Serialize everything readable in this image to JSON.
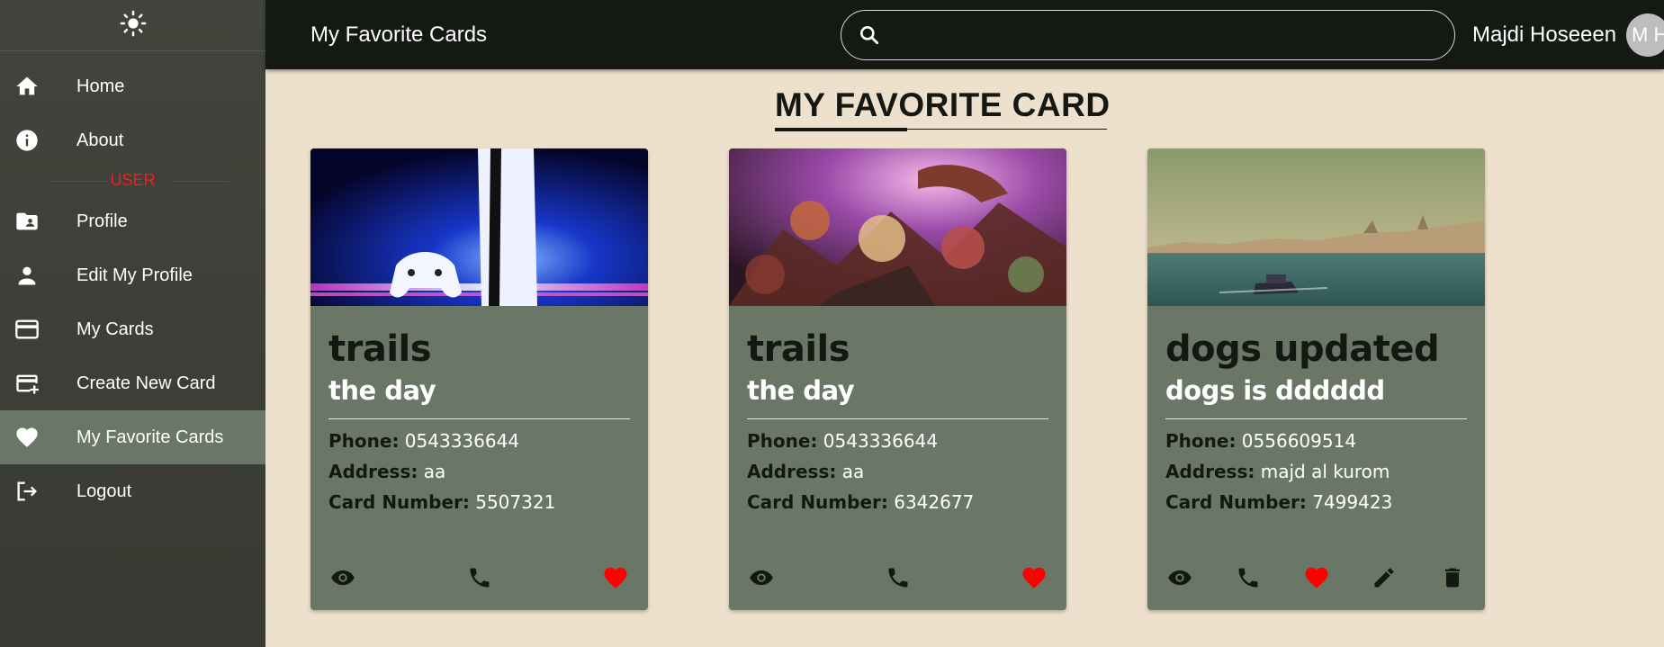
{
  "sidebar": {
    "theme_toggle_icon": "sun-icon",
    "section_label": "USER",
    "items": [
      {
        "label": "Home",
        "icon": "home-icon"
      },
      {
        "label": "About",
        "icon": "info-icon"
      },
      {
        "label": "Profile",
        "icon": "profile-folder-icon"
      },
      {
        "label": "Edit My Profile",
        "icon": "person-icon"
      },
      {
        "label": "My Cards",
        "icon": "credit-card-icon"
      },
      {
        "label": "Create New Card",
        "icon": "add-card-icon"
      },
      {
        "label": "My Favorite Cards",
        "icon": "heart-icon",
        "active": true
      },
      {
        "label": "Logout",
        "icon": "logout-icon"
      }
    ]
  },
  "header": {
    "title": "My Favorite Cards",
    "search_placeholder": "",
    "user_name": "Majdi Hoseeen",
    "avatar_initials": "M H"
  },
  "main": {
    "page_title": "MY FAVORITE CARD",
    "cards": [
      {
        "title": "trails",
        "subtitle": "the day",
        "phone_label": "Phone:",
        "phone": "0543336644",
        "address_label": "Address:",
        "address": "aa",
        "card_number_label": "Card Number:",
        "card_number": "5507321",
        "image": "game-console-image",
        "actions": [
          "eye-icon",
          "phone-icon",
          "heart-icon"
        ]
      },
      {
        "title": "trails",
        "subtitle": "the day",
        "phone_label": "Phone:",
        "phone": "0543336644",
        "address_label": "Address:",
        "address": "aa",
        "card_number_label": "Card Number:",
        "card_number": "6342677",
        "image": "game-characters-image",
        "actions": [
          "eye-icon",
          "phone-icon",
          "heart-icon"
        ]
      },
      {
        "title": "dogs updated",
        "subtitle": "dogs is dddddd",
        "phone_label": "Phone:",
        "phone": "0556609514",
        "address_label": "Address:",
        "address": "majd al kurom",
        "card_number_label": "Card Number:",
        "card_number": "7499423",
        "image": "city-sea-image",
        "actions": [
          "eye-icon",
          "phone-icon",
          "heart-icon",
          "edit-icon",
          "delete-icon"
        ]
      }
    ]
  },
  "colors": {
    "sidebar_bg": "#3c3f37",
    "active_item": "#6b7766",
    "header_bg": "#141913",
    "page_bg": "#ede0cc",
    "card_bg": "#6b7766",
    "favorite": "#ff0000",
    "section_label": "#ff1a1a"
  }
}
